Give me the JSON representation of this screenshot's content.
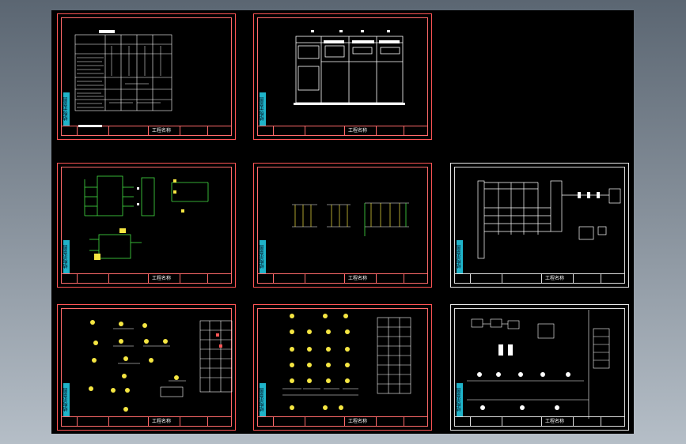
{
  "side_label": "结构示意图",
  "titleblock_text": "工程名称",
  "colors": {
    "bg_top": "#5b6672",
    "bg_bottom": "#b5bec7",
    "canvas": "#000000",
    "border_red": "#ff5555",
    "border_white": "#e8e8e8",
    "line_yellow": "#f5e642",
    "line_green": "#44e044",
    "accent_cyan": "#1fb3c9"
  },
  "sheets": [
    {
      "id": "sheet-1",
      "content": "table-schematic"
    },
    {
      "id": "sheet-2",
      "content": "cabinet-elevation"
    },
    {
      "id": "sheet-3",
      "content": "green-wiring"
    },
    {
      "id": "sheet-4",
      "content": "circuit-groups"
    },
    {
      "id": "sheet-5",
      "content": "busbar-diagram"
    },
    {
      "id": "sheet-6",
      "content": "yellow-symbols-table"
    },
    {
      "id": "sheet-7",
      "content": "yellow-symbols-grid"
    },
    {
      "id": "sheet-8",
      "content": "white-schematic"
    }
  ]
}
